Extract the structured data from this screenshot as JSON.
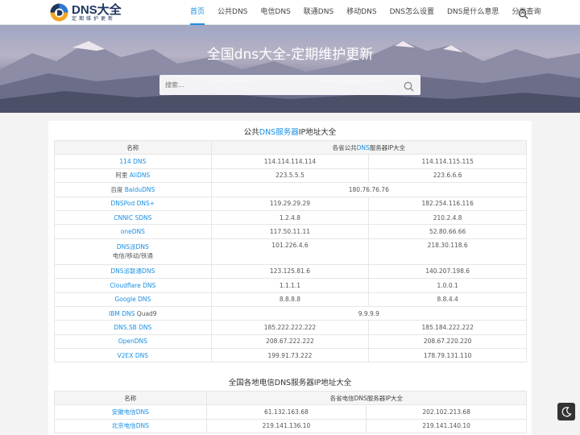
{
  "header": {
    "logo_title": "DNS大全",
    "logo_sub": "定期维护更新",
    "nav": [
      {
        "label": "首页",
        "active": true
      },
      {
        "label": "公共DNS"
      },
      {
        "label": "电信DNS"
      },
      {
        "label": "联通DNS"
      },
      {
        "label": "移动DNS"
      },
      {
        "label": "DNS怎么设置"
      },
      {
        "label": "DNS是什么意思"
      },
      {
        "label": "分类查询"
      }
    ]
  },
  "hero": {
    "title": "全国dns大全-定期维护更新",
    "search_placeholder": "搜索..."
  },
  "section1": {
    "title_pre": "公共",
    "title_hl": "DNS服务器",
    "title_post": "IP地址大全",
    "col_name": "名称",
    "col_ip_pre": "各省公共",
    "col_ip_hl": "DNS",
    "col_ip_post": "服务器IP大全",
    "rows": [
      {
        "name": "114 DNS",
        "ip1": "114.114.114.114",
        "ip2": "114.114.115.115"
      },
      {
        "prefix": "阿里 ",
        "name": "AliDNS",
        "ip1": "223.5.5.5",
        "ip2": "223.6.6.6"
      },
      {
        "prefix": "百度 ",
        "name": "BaiduDNS",
        "ip_merged": "180.76.76.76"
      },
      {
        "name": "DNSPod DNS+",
        "ip1": "119.29.29.29",
        "ip2": "182.254.116.116"
      },
      {
        "name": "CNNIC SDNS",
        "ip1": "1.2.4.8",
        "ip2": "210.2.4.8"
      },
      {
        "name": "oneDNS",
        "ip1": "117.50.11.11",
        "ip2": "52.80.66.66"
      },
      {
        "name": "DNS派DNS",
        "note": "电信/移动/铁通",
        "ip1": "101.226.4.6",
        "ip2": "218.30.118.6",
        "tall": true
      },
      {
        "name": "DNS派联通DNS",
        "ip1": "123.125.81.6",
        "ip2": "140.207.198.6"
      },
      {
        "name": "Cloudflare DNS",
        "ip1": "1.1.1.1",
        "ip2": "1.0.0.1"
      },
      {
        "name": "Google DNS",
        "ip1": "8.8.8.8",
        "ip2": "8.8.4.4"
      },
      {
        "name": "IBM DNS",
        "suffix": " Quad9",
        "ip_merged": "9.9.9.9"
      },
      {
        "name": "DNS.SB DNS",
        "ip1": "185.222.222.222",
        "ip2": "185.184.222.222"
      },
      {
        "name": "OpenDNS",
        "ip1": "208.67.222.222",
        "ip2": "208.67.220.220"
      },
      {
        "name": "V2EX DNS",
        "ip1": "199.91.73.222",
        "ip2": "178.79.131.110"
      }
    ]
  },
  "section2": {
    "title": "全国各地电信DNS服务器IP地址大全",
    "col_name": "名称",
    "col_ip": "各省电信DNS服务器IP大全",
    "rows": [
      {
        "name": "安徽电信DNS",
        "ip1": "61.132.163.68",
        "ip2": "202.102.213.68"
      },
      {
        "name": "北京电信DNS",
        "ip1": "219.141.136.10",
        "ip2": "219.141.140.10"
      }
    ]
  }
}
